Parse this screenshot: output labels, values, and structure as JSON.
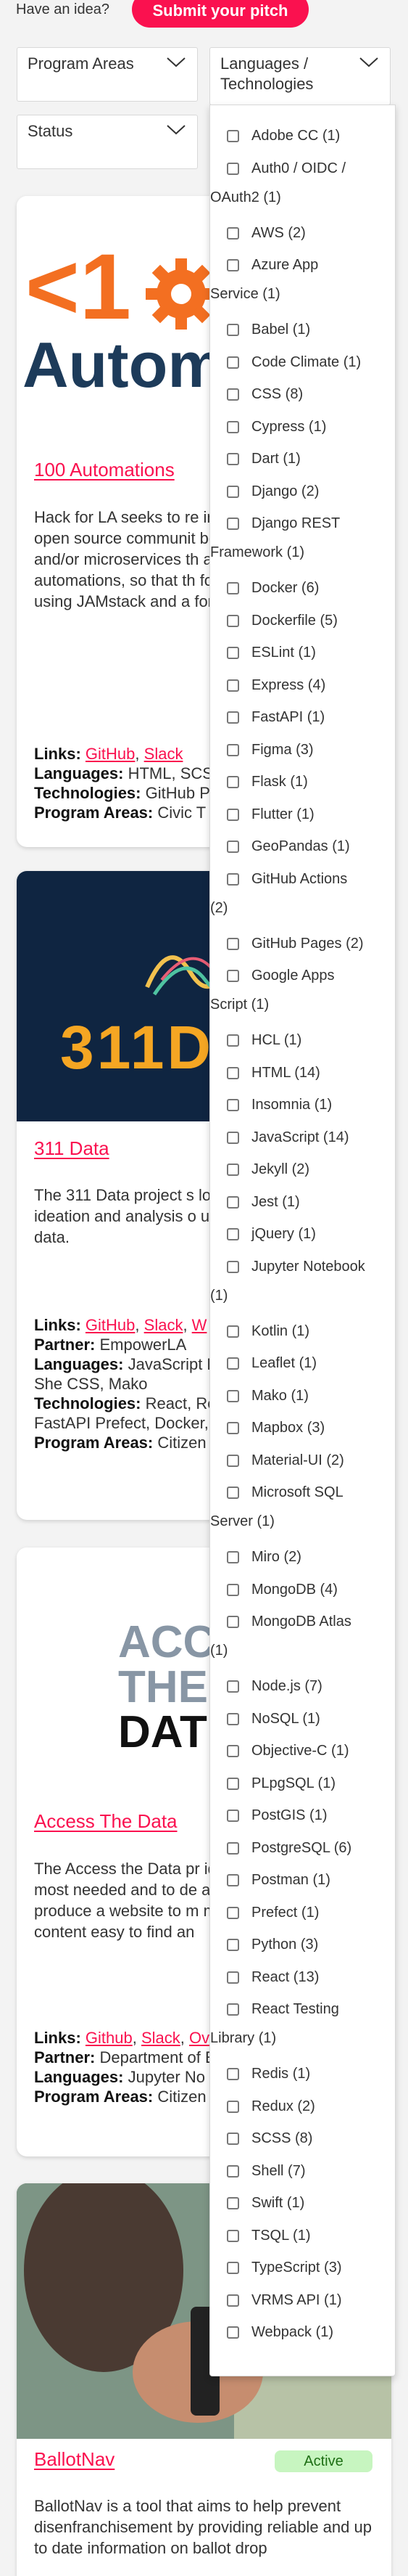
{
  "header": {
    "prompt": "Have an idea?",
    "pitch_button": "Submit your pitch"
  },
  "filters": {
    "program_areas": "Program Areas",
    "languages_technologies": "Languages / Technologies",
    "status": "Status"
  },
  "technologies": [
    {
      "label": "Adobe CC (1)"
    },
    {
      "label": "Auth0 / OIDC /",
      "cont": "OAuth2 (1)"
    },
    {
      "label": "AWS (2)"
    },
    {
      "label": "Azure App",
      "cont": "Service (1)"
    },
    {
      "label": "Babel (1)"
    },
    {
      "label": "Code Climate (1)"
    },
    {
      "label": "CSS (8)"
    },
    {
      "label": "Cypress (1)"
    },
    {
      "label": "Dart (1)"
    },
    {
      "label": "Django (2)"
    },
    {
      "label": "Django REST",
      "cont": "Framework (1)"
    },
    {
      "label": "Docker (6)"
    },
    {
      "label": "Dockerfile (5)"
    },
    {
      "label": "ESLint (1)"
    },
    {
      "label": "Express (4)"
    },
    {
      "label": "FastAPI (1)"
    },
    {
      "label": "Figma (3)"
    },
    {
      "label": "Flask (1)"
    },
    {
      "label": "Flutter (1)"
    },
    {
      "label": "GeoPandas (1)"
    },
    {
      "label": "GitHub Actions",
      "cont": "(2)"
    },
    {
      "label": "GitHub Pages (2)"
    },
    {
      "label": "Google Apps",
      "cont": "Script (1)"
    },
    {
      "label": "HCL (1)"
    },
    {
      "label": "HTML (14)"
    },
    {
      "label": "Insomnia (1)"
    },
    {
      "label": "JavaScript (14)"
    },
    {
      "label": "Jekyll (2)"
    },
    {
      "label": "Jest (1)"
    },
    {
      "label": "jQuery (1)"
    },
    {
      "label": "Jupyter Notebook",
      "cont": "(1)"
    },
    {
      "label": "Kotlin (1)"
    },
    {
      "label": "Leaflet (1)"
    },
    {
      "label": "Mako (1)"
    },
    {
      "label": "Mapbox (3)"
    },
    {
      "label": "Material-UI (2)"
    },
    {
      "label": "Microsoft SQL",
      "cont": "Server (1)"
    },
    {
      "label": "Miro (2)"
    },
    {
      "label": "MongoDB (4)"
    },
    {
      "label": "MongoDB Atlas",
      "cont": "(1)"
    },
    {
      "label": "Node.js (7)"
    },
    {
      "label": "NoSQL (1)"
    },
    {
      "label": "Objective-C (1)"
    },
    {
      "label": "PLpgSQL (1)"
    },
    {
      "label": "PostGIS (1)"
    },
    {
      "label": "PostgreSQL (6)"
    },
    {
      "label": "Postman (1)"
    },
    {
      "label": "Prefect (1)"
    },
    {
      "label": "Python (3)"
    },
    {
      "label": "React (13)"
    },
    {
      "label": "React Testing",
      "cont": "Library (1)"
    },
    {
      "label": "Redis (1)"
    },
    {
      "label": "Redux (2)"
    },
    {
      "label": "SCSS (8)"
    },
    {
      "label": "Shell (7)"
    },
    {
      "label": "Swift (1)"
    },
    {
      "label": "TSQL (1)"
    },
    {
      "label": "TypeScript (3)"
    },
    {
      "label": "VRMS API (1)"
    },
    {
      "label": "Webpack (1)"
    }
  ],
  "labels": {
    "links": "Links:",
    "partner": "Partner:",
    "languages": "Languages:",
    "technologies": "Technologies:",
    "program_areas": "Program Areas:"
  },
  "projects": [
    {
      "hero_text_1": "<1",
      "hero_text_2": "Autom",
      "title": "100 Automations",
      "description": "Hack for LA seeks to re in our open source proj open source communit both a showcase for th and/or microservices th also a convenient home automations, so that th forked, and contributed using JAMstack and a for building this websit",
      "links": [
        "GitHub",
        "Slack"
      ],
      "languages": "HTML, SCS",
      "technologies": "GitHub P",
      "program_areas": "Civic T"
    },
    {
      "hero_text": "311D",
      "title": "311 Data",
      "description": "The 311 Data project s local Neighborhood Co ideation and analysis o using the wealth of pub data.",
      "links": [
        "GitHub",
        "Slack",
        "W"
      ],
      "partner": "EmpowerLA",
      "languages": "JavaScript Python, SCSS, HCL, She CSS, Mako",
      "technologies": "React, Re Mapbox, AWS, FastAPI Prefect, Docker, Figma,",
      "program_areas": "Citizen"
    },
    {
      "hero_text_1": "ACC",
      "hero_text_2": "THE",
      "hero_text_3": "DAT",
      "title": "Access The Data",
      "description": "The Access the Data pr identify where data lite most needed and to de address those areas. T produce a website to m modules and other rele content easy to find an",
      "links": [
        "Github",
        "Slack",
        "Ov"
      ],
      "partner": "Department of Empowerment",
      "languages": "Jupyter No",
      "program_areas": "Citizen"
    },
    {
      "title": "BallotNav",
      "status": "Active",
      "description": "BallotNav is a tool that aims to help prevent disenfranchisement by providing reliable and up to date information on ballot drop"
    }
  ]
}
